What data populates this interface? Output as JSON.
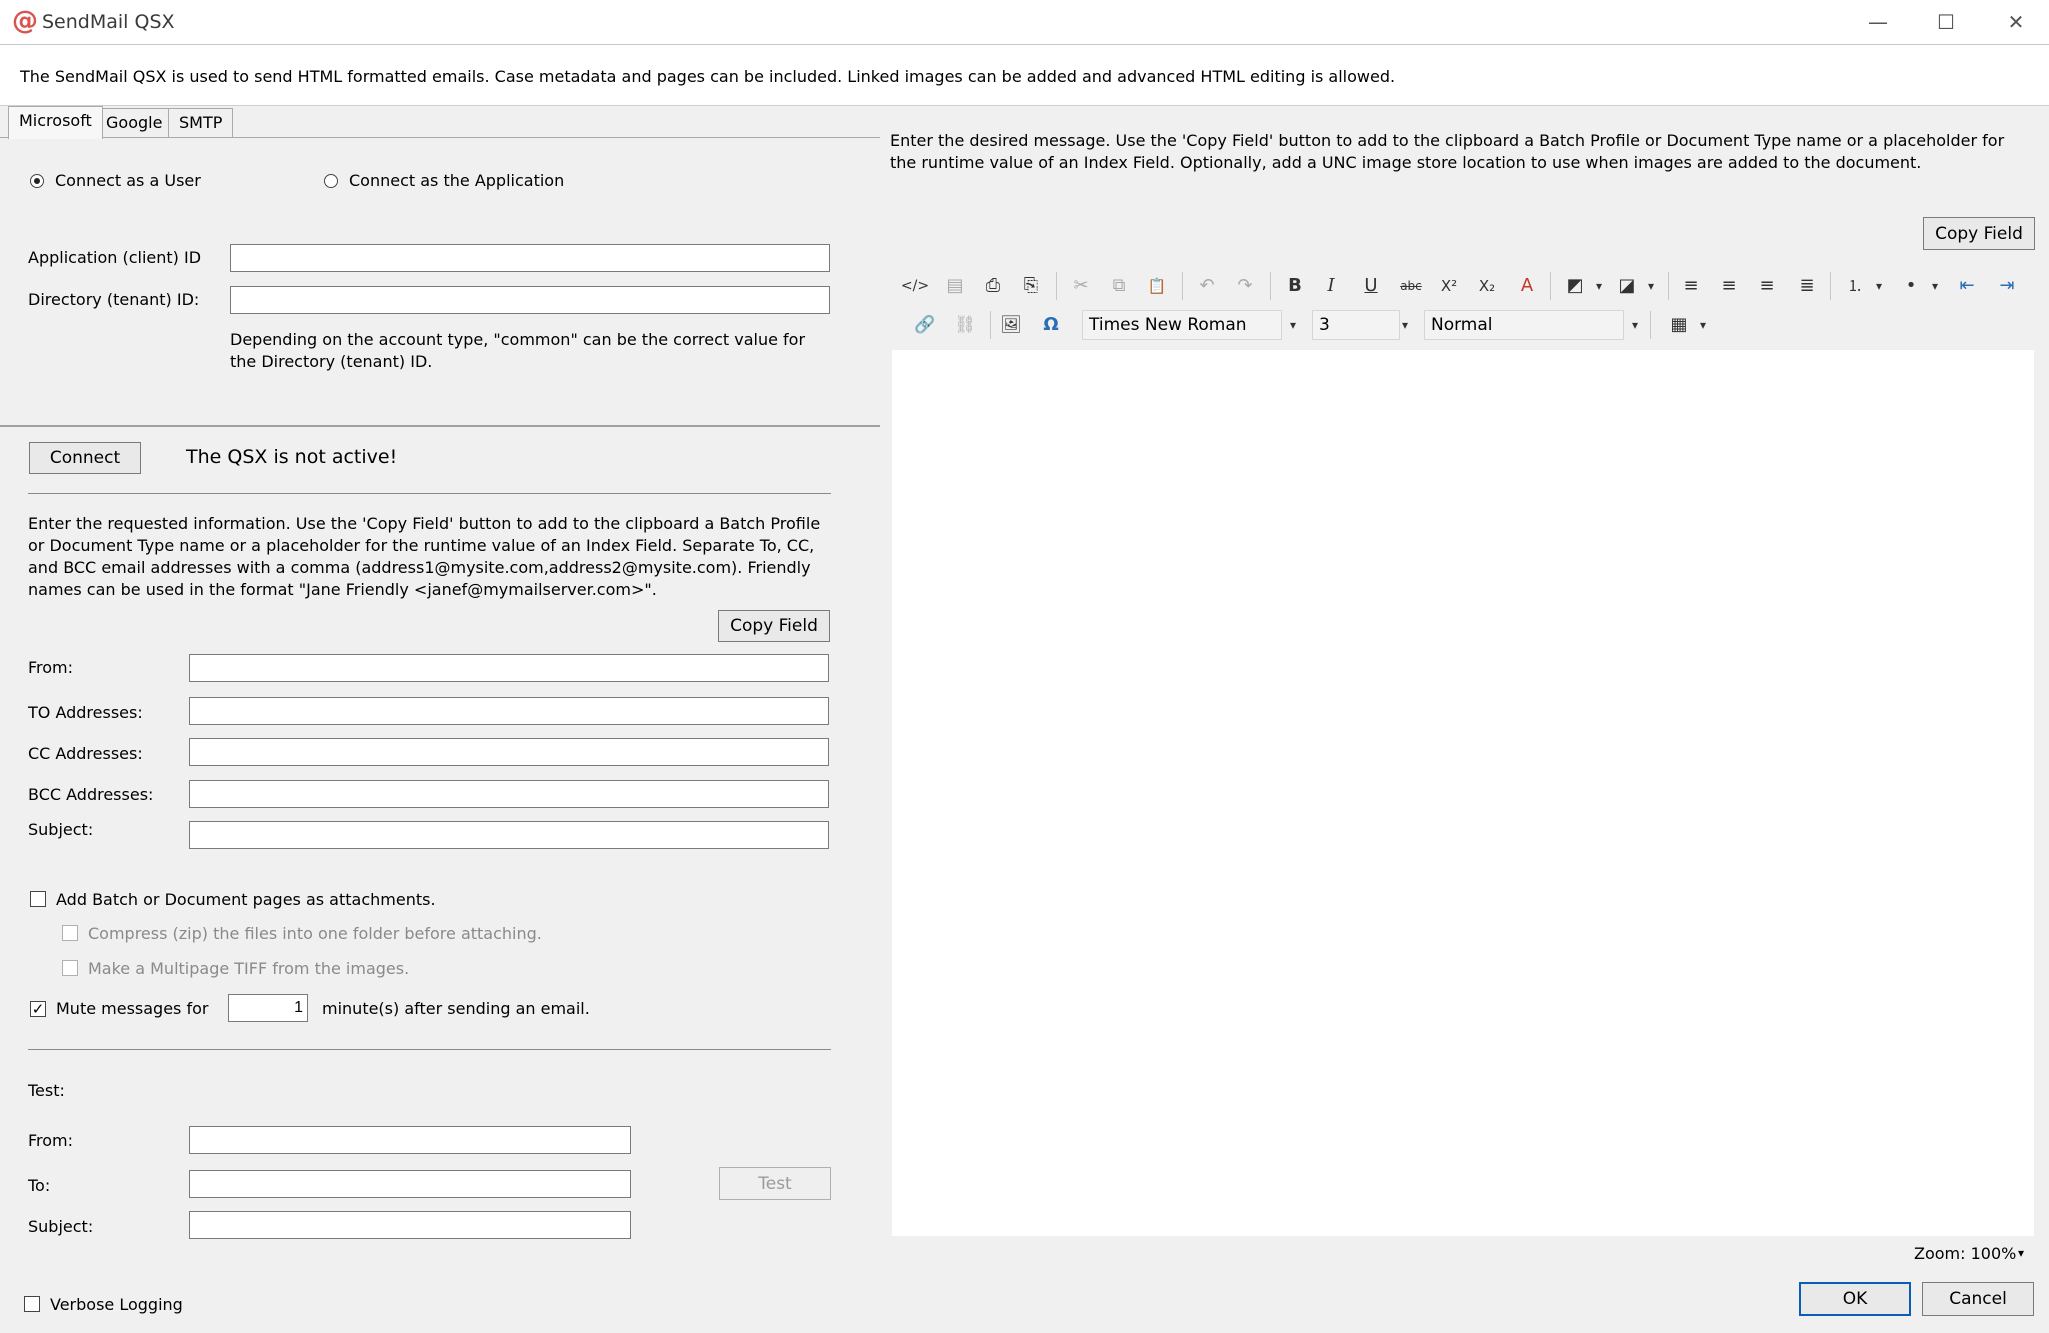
{
  "window": {
    "title": "SendMail QSX",
    "app_icon_glyph": "@",
    "minimize_glyph": "—",
    "maximize_glyph": "☐",
    "close_glyph": "✕"
  },
  "description": "The SendMail QSX is used to send HTML formatted emails.  Case metadata and pages can be included.  Linked images can be added and advanced HTML editing is allowed.",
  "tabs": [
    {
      "label": "Microsoft",
      "active": true
    },
    {
      "label": "Google",
      "active": false
    },
    {
      "label": "SMTP",
      "active": false
    }
  ],
  "connection": {
    "mode_user_label": "Connect as a User",
    "mode_app_label": "Connect as the Application",
    "selected_mode": "user",
    "app_id_label": "Application (client) ID",
    "app_id_value": "",
    "tenant_id_label": "Directory (tenant) ID:",
    "tenant_id_value": "",
    "tenant_hint": "Depending on the account type, \"common\" can be the correct value for the Directory (tenant) ID.",
    "connect_button": "Connect",
    "status": "The QSX is not active!"
  },
  "email": {
    "instructions": "Enter the requested information.  Use the 'Copy Field' button to add to the clipboard a Batch Profile or Document Type name or a placeholder for the runtime value of an Index Field.  Separate To, CC, and BCC email addresses with a comma (address1@mysite.com,address2@mysite.com).  Friendly names can be used in the format \"Jane Friendly <janef@mymailserver.com>\".",
    "copy_field_button": "Copy Field",
    "from_label": "From:",
    "to_label": "TO Addresses:",
    "cc_label": "CC Addresses:",
    "bcc_label": "BCC Addresses:",
    "subject_label": "Subject:",
    "from_value": "",
    "to_value": "",
    "cc_value": "",
    "bcc_value": "",
    "subject_value": ""
  },
  "attachments": {
    "add_pages_label": "Add Batch or Document pages as attachments.",
    "add_pages_checked": false,
    "compress_label": "Compress (zip) the files into one folder before attaching.",
    "compress_checked": false,
    "tiff_label": "Make a Multipage TIFF from the images.",
    "tiff_checked": false,
    "mute_label": "Mute messages for",
    "mute_checked": true,
    "mute_minutes": "1",
    "mute_suffix": "minute(s) after sending an email.",
    "check_glyph": "✓"
  },
  "test": {
    "section_label": "Test:",
    "from_label": "From:",
    "to_label": "To:",
    "subject_label": "Subject:",
    "from_value": "",
    "to_value": "",
    "subject_value": "",
    "test_button": "Test"
  },
  "verbose_logging_label": "Verbose Logging",
  "verbose_logging_checked": false,
  "message": {
    "instructions": "Enter the desired message.  Use the 'Copy Field' button to add to the clipboard a Batch Profile or Document Type name or a placeholder for the runtime value of an Index Field. Optionally, add a UNC image store location to use when images are added to the document.",
    "copy_field_button": "Copy Field",
    "font_name": "Times New Roman",
    "font_size": "3",
    "paragraph_style": "Normal",
    "zoom": "Zoom: 100%",
    "body": ""
  },
  "toolbar_glyphs": {
    "source": "</>",
    "select_all": "▤",
    "print": "⎙",
    "print_preview": "⎘",
    "cut": "✂",
    "copy": "⧉",
    "paste": "📋",
    "undo": "↶",
    "redo": "↷",
    "bold": "B",
    "italic": "I",
    "underline": "U",
    "strike": "abc",
    "superscript": "X²",
    "subscript": "X₂",
    "clear_format": "A",
    "fore_color": "◩",
    "back_color": "◪",
    "align_left": "≡",
    "align_center": "≡",
    "align_right": "≡",
    "justify": "≣",
    "numbered_list": "⒈",
    "bullet_list": "•",
    "outdent": "⇤",
    "indent": "⇥",
    "link": "🔗",
    "unlink": "⛓",
    "image": "🖼",
    "symbol": "Ω",
    "table": "▦",
    "dropdown": "▾"
  },
  "footer": {
    "ok_button": "OK",
    "cancel_button": "Cancel"
  },
  "colors": {
    "accent": "#0a5fb5",
    "app_icon": "#d9534f",
    "background": "#f0f0f0"
  }
}
